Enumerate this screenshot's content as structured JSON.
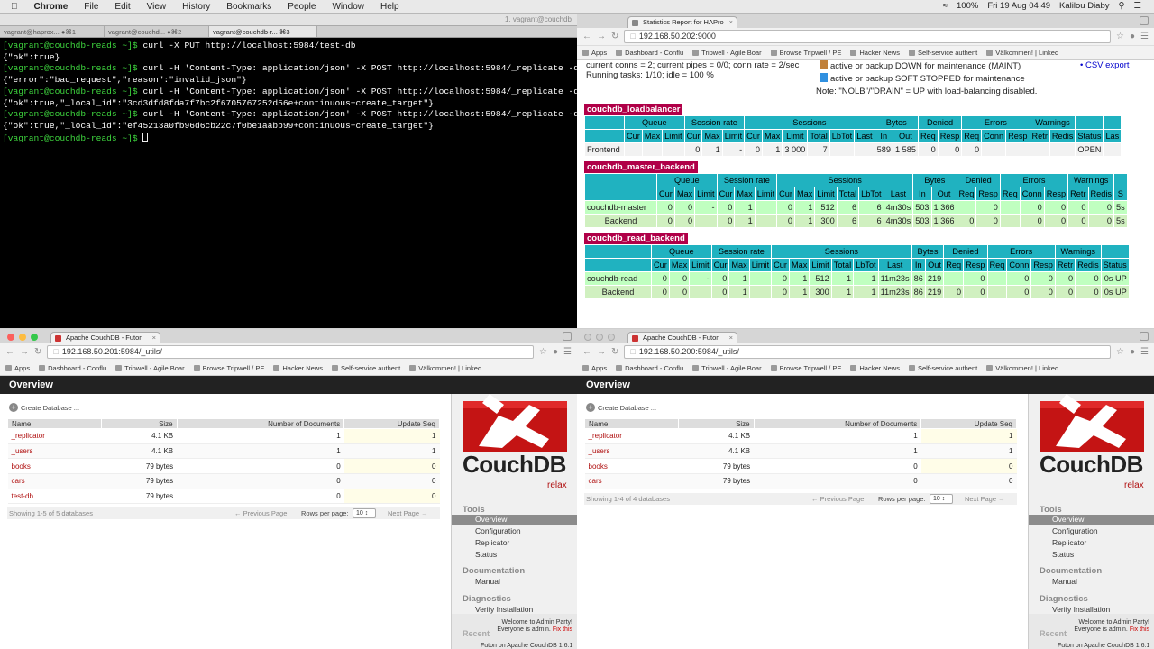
{
  "menubar": {
    "app": "Chrome",
    "items": [
      "File",
      "Edit",
      "View",
      "History",
      "Bookmarks",
      "People",
      "Window",
      "Help"
    ],
    "battery": "100%",
    "datetime": "Fri 19 Aug  04 49",
    "user": "Kalilou Diaby"
  },
  "terminal": {
    "title": "1. vagrant@couchdb",
    "tabs": [
      "vagrant@haprox... ●⌘1",
      "vagrant@couchd... ●⌘2",
      "vagrant@couchdb-r... ⌘3"
    ],
    "lines": [
      {
        "prompt": "[vagrant@couchdb-reads ~]$",
        "cmd": " curl -X PUT http://localhost:5984/test-db"
      },
      {
        "out": "{\"ok\":true}"
      },
      {
        "prompt": "[vagrant@couchdb-reads ~]$",
        "cmd": " curl -H 'Content-Type: application/json' -X POST http://localhost:5984/_replicate -d ' {\"sou"
      },
      {
        "out": "{\"error\":\"bad_request\",\"reason\":\"invalid_json\"}"
      },
      {
        "prompt": "[vagrant@couchdb-reads ~]$",
        "cmd": " curl -H 'Content-Type: application/json' -X POST http://localhost:5984/_replicate -d ' {\"sou"
      },
      {
        "out": "{\"ok\":true,\"_local_id\":\"3cd3dfd8fda7f7bc2f6705767252d56e+continuous+create_target\"}"
      },
      {
        "prompt": "[vagrant@couchdb-reads ~]$",
        "cmd": " curl -H 'Content-Type: application/json' -X POST http://localhost:5984/_replicate -d ' {\"sou"
      },
      {
        "out": "{\"ok\":true,\"_local_id\":\"ef45213a0fb96d6cb22c7f0be1aabb99+continuous+create_target\"}"
      },
      {
        "prompt": "[vagrant@couchdb-reads ~]$",
        "cmd": " "
      }
    ]
  },
  "bookmarks": [
    "Apps",
    "Dashboard - Conflu",
    "Tripwell - Agile Boar",
    "Browse Tripwell / PE",
    "Hacker News",
    "Self-service authent",
    "Välkommen! | Linked"
  ],
  "haproxy": {
    "tab": "Statistics Report for HAPro",
    "url": "192.168.50.202:9000",
    "status_lines": [
      "current conns = 2; current pipes = 0/0; conn rate = 2/sec",
      "Running tasks: 1/10; idle = 100 %"
    ],
    "legend": [
      "active or backup DOWN for maintenance (MAINT)",
      "active or backup SOFT STOPPED for maintenance"
    ],
    "note": "Note: \"NOLB\"/\"DRAIN\" = UP with load-balancing disabled.",
    "csv": "CSV export",
    "sections": [
      {
        "name": "couchdb_loadbalancer",
        "h1": [
          "",
          "Queue",
          "Session rate",
          "Sessions",
          "Bytes",
          "Denied",
          "Errors",
          "Warnings",
          "",
          ""
        ],
        "h2": [
          "",
          "Cur",
          "Max",
          "Limit",
          "Cur",
          "Max",
          "Limit",
          "Cur",
          "Max",
          "Limit",
          "Total",
          "LbTot",
          "Last",
          "In",
          "Out",
          "Req",
          "Resp",
          "Req",
          "Conn",
          "Resp",
          "Retr",
          "Redis",
          "Status",
          "Las"
        ],
        "rows": [
          [
            "Frontend",
            "",
            "",
            "",
            "0",
            "1",
            "-",
            "0",
            "1",
            "3 000",
            "7",
            "",
            "",
            "589",
            "1 585",
            "0",
            "0",
            "0",
            "",
            "",
            "",
            "",
            "OPEN",
            ""
          ]
        ]
      },
      {
        "name": "couchdb_master_backend",
        "h1": [
          "",
          "Queue",
          "Session rate",
          "Sessions",
          "Bytes",
          "Denied",
          "Errors",
          "Warnings",
          ""
        ],
        "h2": [
          "",
          "Cur",
          "Max",
          "Limit",
          "Cur",
          "Max",
          "Limit",
          "Cur",
          "Max",
          "Limit",
          "Total",
          "LbTot",
          "Last",
          "In",
          "Out",
          "Req",
          "Resp",
          "Req",
          "Conn",
          "Resp",
          "Retr",
          "Redis",
          "S"
        ],
        "rows": [
          [
            "couchdb-master",
            "0",
            "0",
            "-",
            "0",
            "1",
            "",
            "0",
            "1",
            "512",
            "6",
            "6",
            "4m30s",
            "503",
            "1 366",
            "",
            "0",
            "",
            "0",
            "0",
            "0",
            "0",
            "5s"
          ],
          [
            "Backend",
            "0",
            "0",
            "",
            "0",
            "1",
            "",
            "0",
            "1",
            "300",
            "6",
            "6",
            "4m30s",
            "503",
            "1 366",
            "0",
            "0",
            "",
            "0",
            "0",
            "0",
            "0",
            "5s"
          ]
        ]
      },
      {
        "name": "couchdb_read_backend",
        "h1": [
          "",
          "Queue",
          "Session rate",
          "Sessions",
          "Bytes",
          "Denied",
          "Errors",
          "Warnings",
          ""
        ],
        "h2": [
          "",
          "Cur",
          "Max",
          "Limit",
          "Cur",
          "Max",
          "Limit",
          "Cur",
          "Max",
          "Limit",
          "Total",
          "LbTot",
          "Last",
          "In",
          "Out",
          "Req",
          "Resp",
          "Req",
          "Conn",
          "Resp",
          "Retr",
          "Redis",
          "Status"
        ],
        "rows": [
          [
            "couchdb-read",
            "0",
            "0",
            "-",
            "0",
            "1",
            "",
            "0",
            "1",
            "512",
            "1",
            "1",
            "11m23s",
            "86",
            "219",
            "",
            "0",
            "",
            "0",
            "0",
            "0",
            "0",
            "0s UP"
          ],
          [
            "Backend",
            "0",
            "0",
            "",
            "0",
            "1",
            "",
            "0",
            "1",
            "300",
            "1",
            "1",
            "11m23s",
            "86",
            "219",
            "0",
            "0",
            "",
            "0",
            "0",
            "0",
            "0",
            "0s UP"
          ]
        ]
      }
    ]
  },
  "couch_left": {
    "tab": "Apache CouchDB - Futon",
    "url": "192.168.50.201:5984/_utils/",
    "overview": "Overview",
    "create": "Create Database ...",
    "headers": [
      "Name",
      "Size",
      "Number of Documents",
      "Update Seq"
    ],
    "rows": [
      [
        "_replicator",
        "4.1 KB",
        "1",
        "1"
      ],
      [
        "_users",
        "4.1 KB",
        "1",
        "1"
      ],
      [
        "books",
        "79 bytes",
        "0",
        "0"
      ],
      [
        "cars",
        "79 bytes",
        "0",
        "0"
      ],
      [
        "test-db",
        "79 bytes",
        "0",
        "0"
      ]
    ],
    "showing": "Showing 1-5 of 5 databases",
    "prev": "← Previous Page",
    "rpp": "Rows per page:",
    "rpp_val": "10 ↕",
    "next": "Next Page →"
  },
  "couch_right": {
    "tab": "Apache CouchDB - Futon",
    "url": "192.168.50.200:5984/_utils/",
    "overview": "Overview",
    "create": "Create Database ...",
    "headers": [
      "Name",
      "Size",
      "Number of Documents",
      "Update Seq"
    ],
    "rows": [
      [
        "_replicator",
        "4.1 KB",
        "1",
        "1"
      ],
      [
        "_users",
        "4.1 KB",
        "1",
        "1"
      ],
      [
        "books",
        "79 bytes",
        "0",
        "0"
      ],
      [
        "cars",
        "79 bytes",
        "0",
        "0"
      ]
    ],
    "showing": "Showing 1-4 of 4 databases",
    "prev": "← Previous Page",
    "rpp": "Rows per page:",
    "rpp_val": "10 ↕",
    "next": "Next Page →"
  },
  "sidebar": {
    "logo_word": "CouchDB",
    "relax": "relax",
    "tools": "Tools",
    "tools_items": [
      "Overview",
      "Configuration",
      "Replicator",
      "Status"
    ],
    "documentation": "Documentation",
    "doc_items": [
      "Manual"
    ],
    "diagnostics": "Diagnostics",
    "diag_items": [
      "Verify Installation"
    ],
    "recent": "Recent",
    "welcome": "Welcome to Admin Party!",
    "everyone": "Everyone is admin.",
    "fix": "Fix this",
    "futon": "Futon on Apache CouchDB 1.6.1"
  }
}
